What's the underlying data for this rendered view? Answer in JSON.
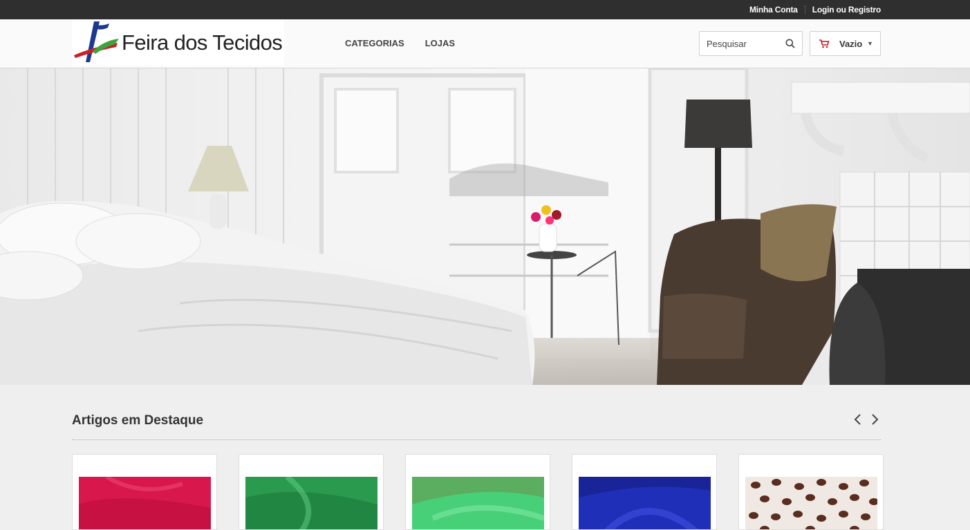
{
  "topbar": {
    "account": "Minha Conta",
    "login": "Login ou Registro"
  },
  "logo": {
    "text": "Feira dos Tecidos"
  },
  "nav": {
    "items": [
      "CATEGORIAS",
      "LOJAS"
    ]
  },
  "search": {
    "placeholder": "Pesquisar"
  },
  "cart": {
    "label": "Vazio"
  },
  "featured": {
    "title": "Artigos em Destaque"
  },
  "products": [
    {
      "name": "pink-fabric",
      "color": "#d8174c"
    },
    {
      "name": "green-sequin-fabric",
      "color": "#2a9a4e"
    },
    {
      "name": "mint-tulle-fabric",
      "color": "#48d079"
    },
    {
      "name": "blue-fabric",
      "color": "#1f2fb8"
    },
    {
      "name": "coffee-bean-print-fabric",
      "color": "#efe8e3"
    }
  ],
  "colors": {
    "topbar": "#2f2f2f",
    "cart_accent": "#c4161c",
    "logo_blue": "#1b3a8f",
    "logo_red": "#c8202a",
    "logo_green": "#3aa53a"
  }
}
